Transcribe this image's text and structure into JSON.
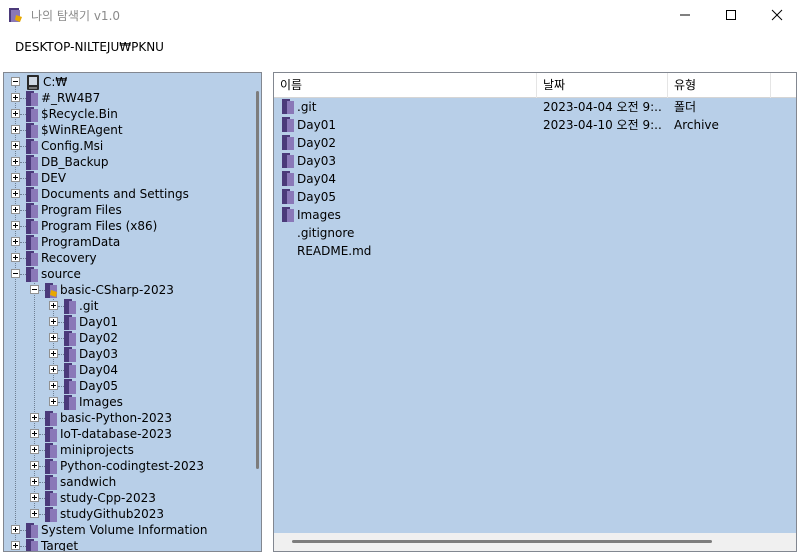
{
  "window": {
    "title": "나의 탐색기 v1.0",
    "path": "DESKTOP-NILTEJU₩PKNU"
  },
  "tree": {
    "root": "C:₩",
    "items": [
      {
        "label": "#_RW4B7",
        "level": 1,
        "expander": "plus"
      },
      {
        "label": "$Recycle.Bin",
        "level": 1,
        "expander": "plus"
      },
      {
        "label": "$WinREAgent",
        "level": 1,
        "expander": "plus"
      },
      {
        "label": "Config.Msi",
        "level": 1,
        "expander": "plus"
      },
      {
        "label": "DB_Backup",
        "level": 1,
        "expander": "plus"
      },
      {
        "label": "DEV",
        "level": 1,
        "expander": "plus"
      },
      {
        "label": "Documents and Settings",
        "level": 1,
        "expander": "plus"
      },
      {
        "label": "Program Files",
        "level": 1,
        "expander": "plus"
      },
      {
        "label": "Program Files (x86)",
        "level": 1,
        "expander": "plus"
      },
      {
        "label": "ProgramData",
        "level": 1,
        "expander": "plus"
      },
      {
        "label": "Recovery",
        "level": 1,
        "expander": "plus"
      },
      {
        "label": "source",
        "level": 1,
        "expander": "minus"
      },
      {
        "label": "basic-CSharp-2023",
        "level": 2,
        "expander": "minus",
        "open": true
      },
      {
        "label": ".git",
        "level": 3,
        "expander": "plus"
      },
      {
        "label": "Day01",
        "level": 3,
        "expander": "plus"
      },
      {
        "label": "Day02",
        "level": 3,
        "expander": "plus"
      },
      {
        "label": "Day03",
        "level": 3,
        "expander": "plus"
      },
      {
        "label": "Day04",
        "level": 3,
        "expander": "plus"
      },
      {
        "label": "Day05",
        "level": 3,
        "expander": "plus"
      },
      {
        "label": "Images",
        "level": 3,
        "expander": "plus"
      },
      {
        "label": "basic-Python-2023",
        "level": 2,
        "expander": "plus"
      },
      {
        "label": "IoT-database-2023",
        "level": 2,
        "expander": "plus"
      },
      {
        "label": "miniprojects",
        "level": 2,
        "expander": "plus"
      },
      {
        "label": "Python-codingtest-2023",
        "level": 2,
        "expander": "plus"
      },
      {
        "label": "sandwich",
        "level": 2,
        "expander": "plus"
      },
      {
        "label": "study-Cpp-2023",
        "level": 2,
        "expander": "plus"
      },
      {
        "label": "studyGithub2023",
        "level": 2,
        "expander": "plus"
      },
      {
        "label": "System Volume Information",
        "level": 1,
        "expander": "plus"
      },
      {
        "label": "Target",
        "level": 1,
        "expander": "plus"
      }
    ]
  },
  "list": {
    "columns": [
      "이름",
      "날짜",
      "유형"
    ],
    "rows": [
      {
        "name": ".git",
        "date": "2023-04-04 오전 9:...",
        "type": "폴더",
        "icon": "folder"
      },
      {
        "name": "Day01",
        "date": "2023-04-10 오전 9:...",
        "type": "Archive",
        "icon": "folder"
      },
      {
        "name": "Day02",
        "date": "",
        "type": "",
        "icon": "folder"
      },
      {
        "name": "Day03",
        "date": "",
        "type": "",
        "icon": "folder"
      },
      {
        "name": "Day04",
        "date": "",
        "type": "",
        "icon": "folder"
      },
      {
        "name": "Day05",
        "date": "",
        "type": "",
        "icon": "folder"
      },
      {
        "name": "Images",
        "date": "",
        "type": "",
        "icon": "folder"
      },
      {
        "name": ".gitignore",
        "date": "",
        "type": "",
        "icon": "none"
      },
      {
        "name": "README.md",
        "date": "",
        "type": "",
        "icon": "none"
      }
    ]
  },
  "colors": {
    "panel_bg": "#b8cfe8",
    "folder_dark": "#4b3a7a",
    "folder_light": "#8a78b8",
    "folder_open_accent": "#e8a800"
  }
}
